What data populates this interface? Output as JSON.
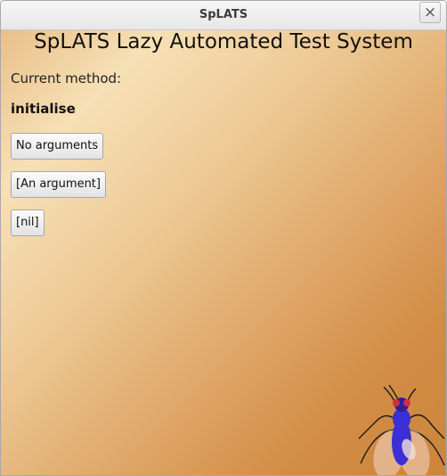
{
  "window": {
    "title": "SpLATS",
    "close_icon": "×"
  },
  "main": {
    "heading": "SpLATS Lazy Automated Test System",
    "current_method_label": "Current method:",
    "current_method_value": "initialise",
    "buttons": [
      {
        "label": "No arguments"
      },
      {
        "label": "[An argument]"
      },
      {
        "label": "[nil]"
      }
    ]
  },
  "icons": {
    "close": "close-icon",
    "decoration": "fly-icon"
  },
  "colors": {
    "gradient_light": "#f6e0b5",
    "gradient_dark": "#cc853b",
    "fly_body": "#3b2fd6"
  }
}
